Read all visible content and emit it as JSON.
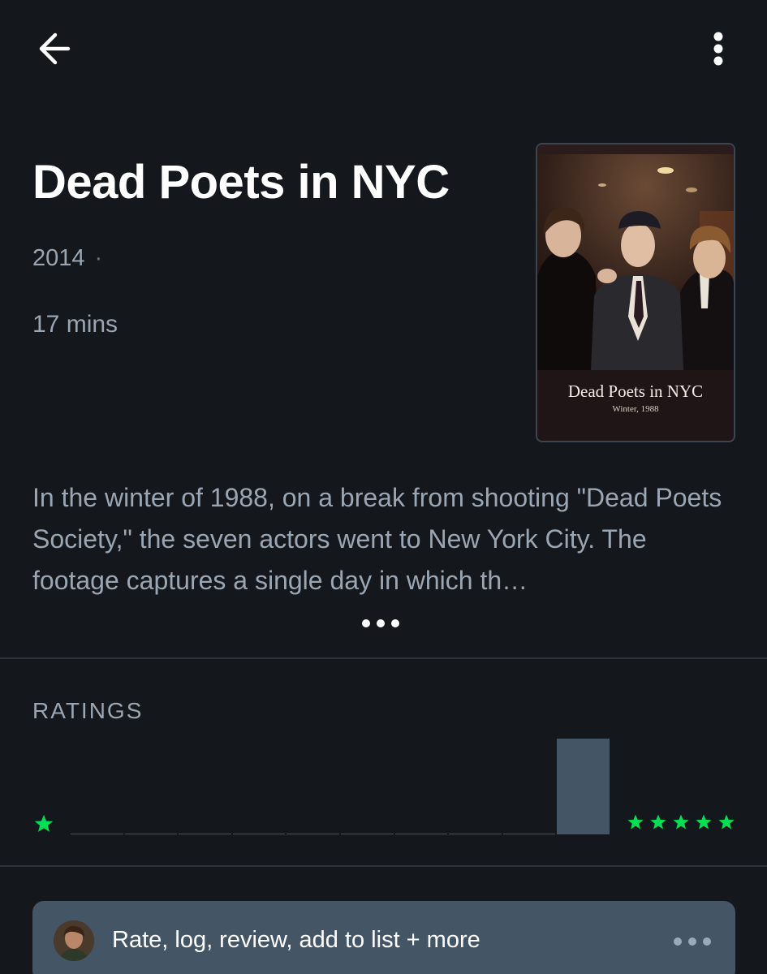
{
  "nav": {
    "back_icon": "arrow-left-icon",
    "menu_icon": "more-vertical-icon"
  },
  "film": {
    "title": "Dead Poets in NYC",
    "year": "2014",
    "year_separator": "·",
    "runtime": "17 mins",
    "synopsis": "In the winter of 1988, on a break from shooting \"Dead Poets Society,\" the seven actors went to New York City. The footage captures a single day in which th…"
  },
  "poster": {
    "title": "Dead Poets in NYC",
    "subtitle": "Winter, 1988"
  },
  "ratings": {
    "label": "RATINGS",
    "low_star_icon": "star-icon",
    "high_stars_icon": "five-stars-icon",
    "distribution": [
      0,
      0,
      0,
      0,
      0,
      0,
      0,
      0,
      0,
      1
    ]
  },
  "action_bar": {
    "label": "Rate, log, review, add to list + more",
    "more_icon": "more-horizontal-icon"
  },
  "colors": {
    "background": "#14181c",
    "muted_text": "#9aa6b3",
    "accent_green": "#00e054",
    "bar": "#445566"
  }
}
